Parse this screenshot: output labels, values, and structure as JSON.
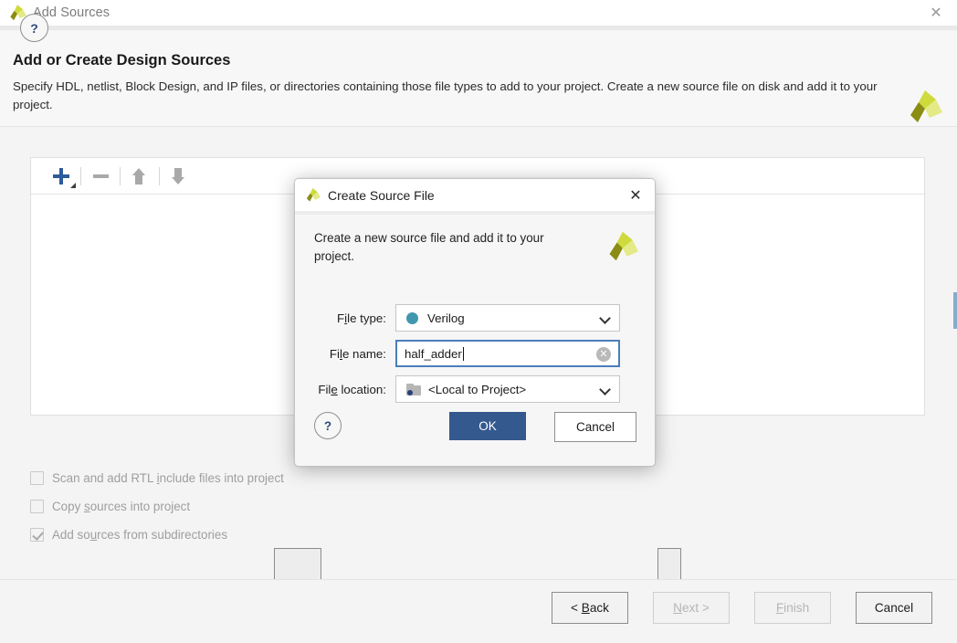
{
  "window": {
    "title": "Add Sources",
    "logo_icon": "xilinx-logo-icon",
    "close_icon": "✕"
  },
  "header": {
    "title": "Add or Create Design Sources",
    "description": "Specify HDL, netlist, Block Design, and IP files, or directories containing those file types to add to your project. Create a new source file on disk and add it to your project.",
    "logo_icon": "xilinx-logo-icon"
  },
  "toolbar": {
    "add_label": "+",
    "add_icon": "plus-icon",
    "remove_icon": "minus-icon",
    "move_up_icon": "arrow-up-icon",
    "move_down_icon": "arrow-down-icon"
  },
  "behind_buttons": [
    {
      "label": ""
    },
    {
      "label": ""
    }
  ],
  "options": [
    {
      "label_before": "Scan and add RTL ",
      "mnemonic": "i",
      "label_after": "nclude files into project",
      "checked": false,
      "name": "scan-rtl-include"
    },
    {
      "label_before": "Copy ",
      "mnemonic": "s",
      "label_after": "ources into project",
      "checked": false,
      "name": "copy-sources"
    },
    {
      "label_before": "Add so",
      "mnemonic": "u",
      "label_after": "rces from subdirectories",
      "checked": true,
      "name": "add-subdirectories"
    }
  ],
  "footer": {
    "help_label": "?",
    "buttons": [
      {
        "label_before": "< ",
        "mnemonic": "B",
        "label_after": "ack",
        "enabled": true,
        "name": "back-button"
      },
      {
        "label_before": "",
        "mnemonic": "N",
        "label_after": "ext >",
        "enabled": false,
        "name": "next-button"
      },
      {
        "label_before": "",
        "mnemonic": "F",
        "label_after": "inish",
        "enabled": false,
        "name": "finish-button"
      },
      {
        "label_before": "Cancel",
        "mnemonic": "",
        "label_after": "",
        "enabled": true,
        "name": "cancel-button"
      }
    ]
  },
  "dialog": {
    "title": "Create Source File",
    "logo_icon": "xilinx-logo-icon",
    "close_icon": "✕",
    "description": "Create a new source file and add it to your project.",
    "fields": {
      "file_type": {
        "label_before": "F",
        "mnemonic": "i",
        "label_after": "le type:",
        "value": "Verilog",
        "icon": "verilog-dot-icon"
      },
      "file_name": {
        "label_before": "Fi",
        "mnemonic": "l",
        "label_after": "e name:",
        "value": "half_adder",
        "clear_icon": "✕"
      },
      "file_location": {
        "label_before": "Fil",
        "mnemonic": "e",
        "label_after": " location:",
        "value": "<Local to Project>",
        "icon": "folder-icon"
      }
    },
    "help_label": "?",
    "ok_label": "OK",
    "cancel_label": "Cancel"
  },
  "colors": {
    "accent_blue": "#34598f",
    "toolbar_plus": "#2d5b99",
    "verilog_dot": "#4097ae",
    "focus_border": "#4a7ebb",
    "logo_dark": "#8b8c12",
    "logo_mid": "#cfdb3c",
    "logo_light": "#e3ea86"
  }
}
